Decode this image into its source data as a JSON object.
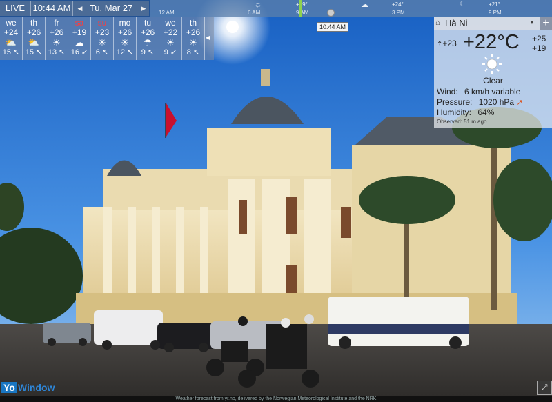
{
  "topbar": {
    "live_label": "LIVE",
    "time": "10:44 AM",
    "date": "Tu, Mar 27",
    "timeline_ticks": [
      "12 AM",
      "6 AM",
      "9 AM",
      "3 PM",
      "9 PM"
    ],
    "timeline_temps": [
      "+19°",
      "+24°",
      "+21°"
    ],
    "now_tag": "10:44 AM"
  },
  "forecast": [
    {
      "day": "we",
      "temp": "+24",
      "icon": "partly-cloudy-icon",
      "wind": "15 ↖",
      "weekend": false
    },
    {
      "day": "th",
      "temp": "+26",
      "icon": "partly-cloudy-icon",
      "wind": "15 ↖",
      "weekend": false
    },
    {
      "day": "fr",
      "temp": "+26",
      "icon": "sun-icon",
      "wind": "13 ↖",
      "weekend": false
    },
    {
      "day": "sa",
      "temp": "+19",
      "icon": "cloud-icon",
      "wind": "16 ↙",
      "weekend": true
    },
    {
      "day": "su",
      "temp": "+23",
      "icon": "sun-icon",
      "wind": "6 ↖",
      "weekend": true
    },
    {
      "day": "mo",
      "temp": "+26",
      "icon": "sun-icon",
      "wind": "12 ↖",
      "weekend": false
    },
    {
      "day": "tu",
      "temp": "+26",
      "icon": "rain-icon",
      "wind": "9 ↖",
      "weekend": false
    },
    {
      "day": "we",
      "temp": "+22",
      "icon": "sun-icon",
      "wind": "9 ↙",
      "weekend": false
    },
    {
      "day": "th",
      "temp": "+26",
      "icon": "sun-icon",
      "wind": "8 ↖",
      "weekend": false
    }
  ],
  "current": {
    "location": "Hà Ni",
    "low": "+23",
    "temp": "+22°C",
    "high_top": "+25",
    "high_bottom": "+19",
    "condition": "Clear",
    "wind_label": "Wind:",
    "wind": "6 km/h variable",
    "pressure_label": "Pressure:",
    "pressure": "1020 hPa",
    "humidity_label": "Humidity:",
    "humidity": "64%",
    "observed": "Observed:  51 m ago"
  },
  "footer": {
    "text": "Weather forecast from yr.no, delivered by the Norwegian Meteorological Institute and the NRK",
    "logo_yo": "Yo",
    "logo_window": "Window"
  },
  "colors": {
    "sky_top": "#1c66c8",
    "sky_bottom": "#7fb6ee",
    "building": "#e8d8a8",
    "accent": "#8fd14f"
  }
}
